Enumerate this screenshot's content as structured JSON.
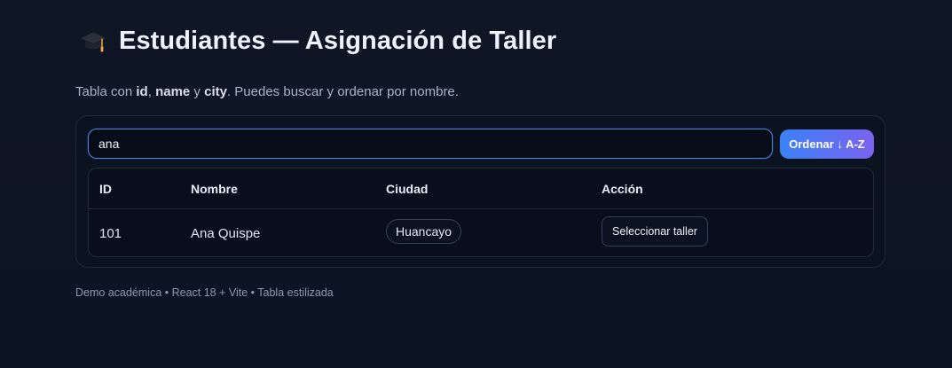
{
  "header": {
    "icon": "graduation-cap-icon",
    "title": "Estudiantes — Asignación de Taller"
  },
  "subtitle": {
    "prefix": "Tabla con ",
    "field_id": "id",
    "sep1": ", ",
    "field_name": "name",
    "sep2": " y ",
    "field_city": "city",
    "suffix": ". Puedes buscar y ordenar por nombre."
  },
  "search": {
    "value": "ana",
    "placeholder": ""
  },
  "toolbar": {
    "sort_label": "Ordenar ↓ A-Z"
  },
  "table": {
    "columns": [
      "ID",
      "Nombre",
      "Ciudad",
      "Acción"
    ],
    "rows": [
      {
        "id": "101",
        "name": "Ana Quispe",
        "city": "Huancayo",
        "action_label": "Seleccionar taller"
      }
    ]
  },
  "footer": {
    "text": "Demo académica • React 18 + Vite • Tabla estilizada"
  },
  "colors": {
    "background": "#0d1424",
    "accent_start": "#3b82f6",
    "accent_end": "#7a63f0",
    "input_border": "#4d82d8"
  }
}
